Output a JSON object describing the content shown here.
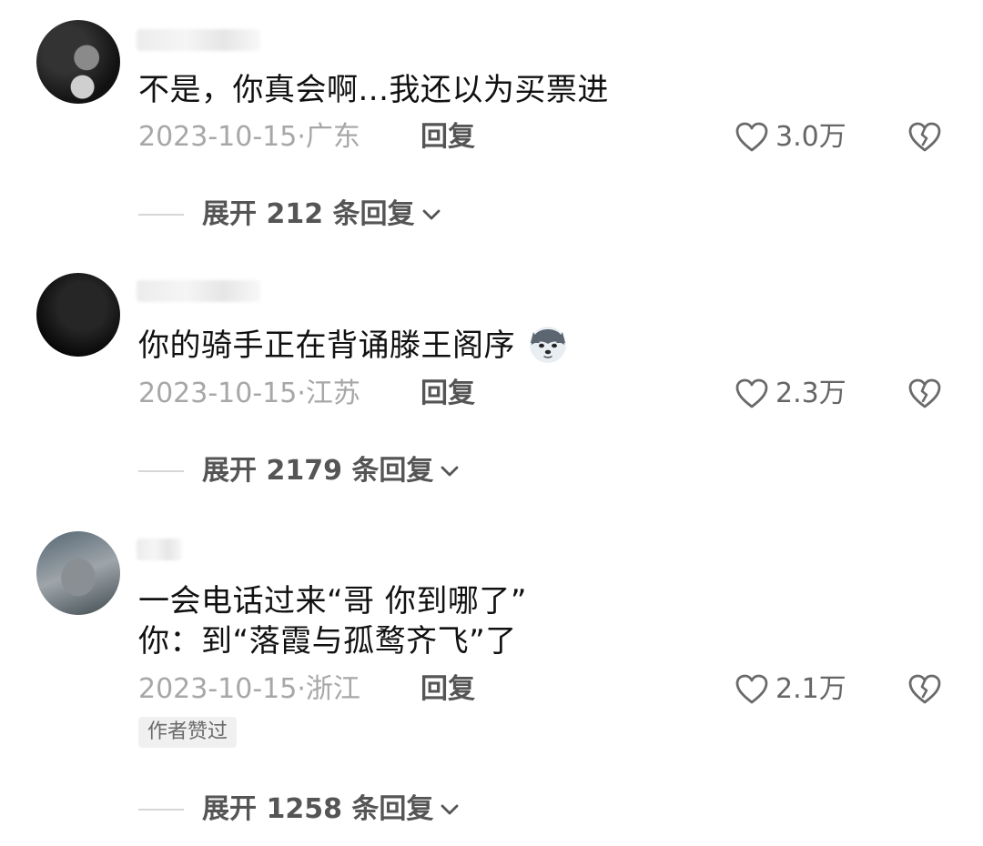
{
  "comments": [
    {
      "text": "不是，你真会啊...我还以为买票进",
      "date": "2023-10-15",
      "location": "广东",
      "reply_label": "回复",
      "likes": "3.0万",
      "expand_label": "展开 212 条回复"
    },
    {
      "text": "你的骑手正在背诵滕王阁序",
      "emoji": "husky-dog-emoji",
      "date": "2023-10-15",
      "location": "江苏",
      "reply_label": "回复",
      "likes": "2.3万",
      "expand_label": "展开 2179 条回复"
    },
    {
      "text_line1": "一会电话过来“哥 你到哪了”",
      "text_line2": "你：到“落霞与孤鹜齐飞”了",
      "date": "2023-10-15",
      "location": "浙江",
      "reply_label": "回复",
      "likes": "2.1万",
      "badge": "作者赞过",
      "expand_label": "展开 1258 条回复"
    }
  ],
  "icons": {
    "like": "heart-outline-icon",
    "dislike": "broken-heart-icon",
    "expand": "chevron-down-icon"
  },
  "colors": {
    "text": "#111111",
    "meta": "#a7a7a7",
    "action": "#555555",
    "badge_bg": "#f0f0f0"
  }
}
